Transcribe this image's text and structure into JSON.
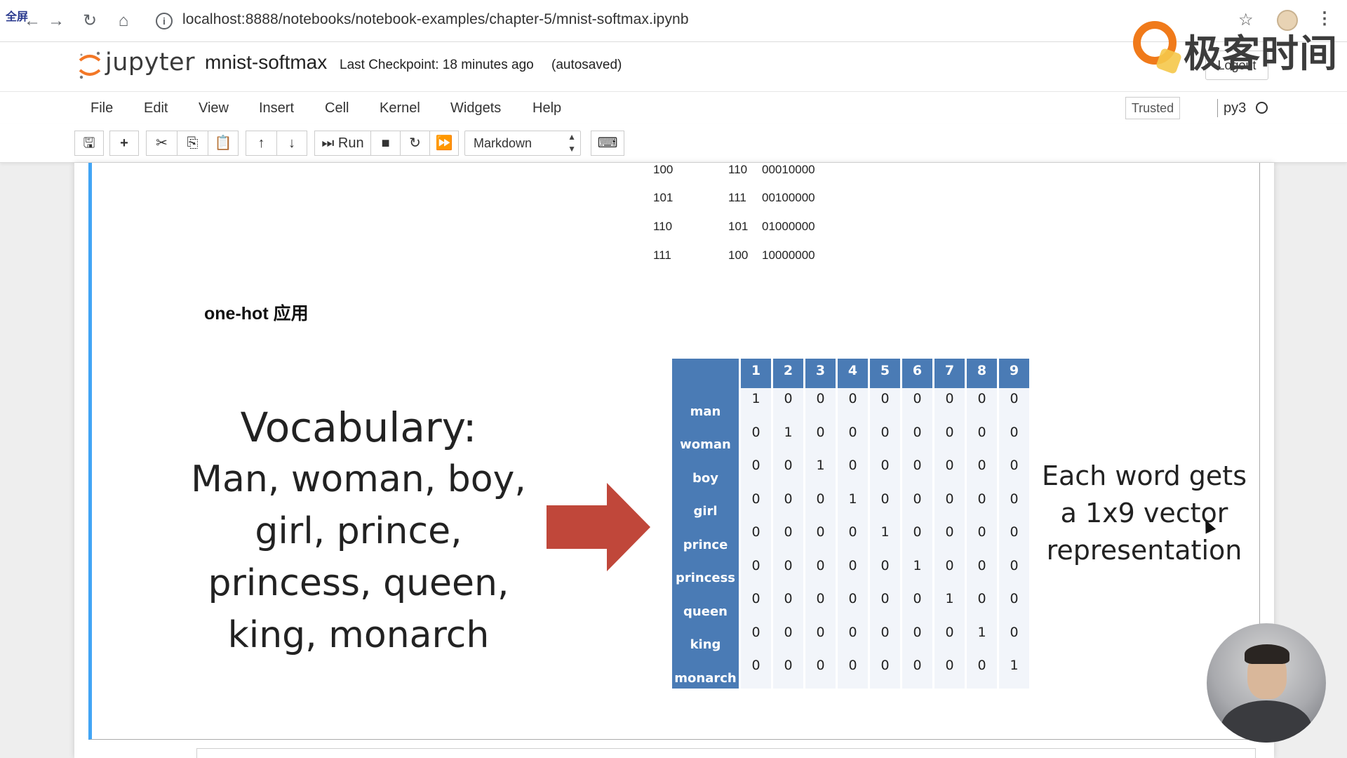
{
  "browser": {
    "fullscreen_tag": "全屏",
    "url": "localhost:8888/notebooks/notebook-examples/chapter-5/mnist-softmax.ipynb"
  },
  "header": {
    "logo_text": "jupyter",
    "notebook_name": "mnist-softmax",
    "checkpoint": "Last Checkpoint: 18 minutes ago",
    "autosaved": "(autosaved)",
    "logout": "Logout",
    "watermark": "极客时间"
  },
  "menubar": {
    "items": [
      "File",
      "Edit",
      "View",
      "Insert",
      "Cell",
      "Kernel",
      "Widgets",
      "Help"
    ],
    "trusted": "Trusted",
    "kernel": "py3"
  },
  "toolbar": {
    "run_label": "Run",
    "cell_type": "Markdown"
  },
  "cell": {
    "binary_rows": [
      [
        "100",
        "110",
        "00010000"
      ],
      [
        "101",
        "111",
        "00100000"
      ],
      [
        "110",
        "101",
        "01000000"
      ],
      [
        "111",
        "100",
        "10000000"
      ]
    ],
    "section_title": "one-hot 应用",
    "vocab_heading": "Vocabulary:",
    "vocab_lines": [
      "Man, woman, boy,",
      "girl, prince,",
      "princess, queen,",
      "king, monarch"
    ],
    "onehot": {
      "columns": [
        "1",
        "2",
        "3",
        "4",
        "5",
        "6",
        "7",
        "8",
        "9"
      ],
      "rows": [
        {
          "word": "man",
          "values": [
            "1",
            "0",
            "0",
            "0",
            "0",
            "0",
            "0",
            "0",
            "0"
          ]
        },
        {
          "word": "woman",
          "values": [
            "0",
            "1",
            "0",
            "0",
            "0",
            "0",
            "0",
            "0",
            "0"
          ]
        },
        {
          "word": "boy",
          "values": [
            "0",
            "0",
            "1",
            "0",
            "0",
            "0",
            "0",
            "0",
            "0"
          ]
        },
        {
          "word": "girl",
          "values": [
            "0",
            "0",
            "0",
            "1",
            "0",
            "0",
            "0",
            "0",
            "0"
          ]
        },
        {
          "word": "prince",
          "values": [
            "0",
            "0",
            "0",
            "0",
            "1",
            "0",
            "0",
            "0",
            "0"
          ]
        },
        {
          "word": "princess",
          "values": [
            "0",
            "0",
            "0",
            "0",
            "0",
            "1",
            "0",
            "0",
            "0"
          ]
        },
        {
          "word": "queen",
          "values": [
            "0",
            "0",
            "0",
            "0",
            "0",
            "0",
            "1",
            "0",
            "0"
          ]
        },
        {
          "word": "king",
          "values": [
            "0",
            "0",
            "0",
            "0",
            "0",
            "0",
            "0",
            "1",
            "0"
          ]
        },
        {
          "word": "monarch",
          "values": [
            "0",
            "0",
            "0",
            "0",
            "0",
            "0",
            "0",
            "0",
            "1"
          ]
        }
      ]
    },
    "each_word_lines": [
      "Each word gets",
      "a 1x9 vector",
      "representation"
    ]
  },
  "colors": {
    "cell_accent": "#42a5f5",
    "table_header": "#4a7bb5",
    "arrow": "#c0473a"
  }
}
